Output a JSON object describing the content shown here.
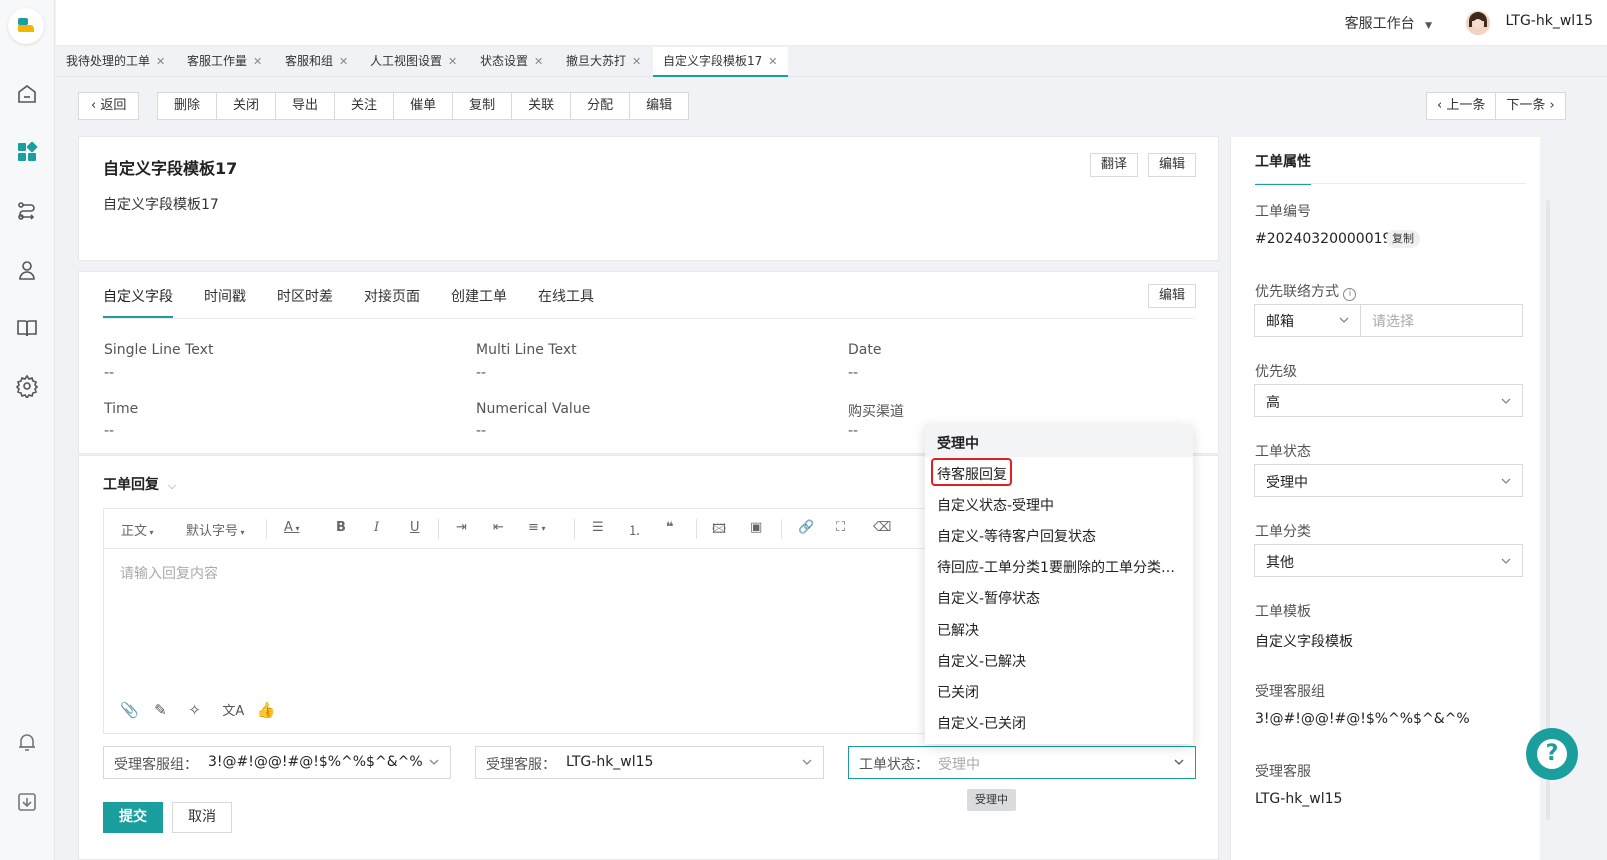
{
  "topbar": {
    "workbench": "客服工作台",
    "username": "LTG-hk_wl15"
  },
  "tabs": [
    {
      "label": "我待处理的工单"
    },
    {
      "label": "客服工作量"
    },
    {
      "label": "客服和组"
    },
    {
      "label": "人工视图设置"
    },
    {
      "label": "状态设置"
    },
    {
      "label": "撤旦大苏打"
    },
    {
      "label": "自定义字段模板17",
      "active": true
    }
  ],
  "toolbar": {
    "back": "返回",
    "actions": [
      "删除",
      "关闭",
      "导出",
      "关注",
      "催单",
      "复制",
      "关联",
      "分配",
      "编辑"
    ],
    "prev": "上一条",
    "next": "下一条"
  },
  "ticket": {
    "title": "自定义字段模板17",
    "description": "自定义字段模板17",
    "translate_label": "翻译",
    "edit_label": "编辑"
  },
  "fields_card": {
    "tabs": [
      "自定义字段",
      "时间戳",
      "时区时差",
      "对接页面",
      "创建工单",
      "在线工具"
    ],
    "edit_label": "编辑",
    "fields": [
      {
        "label": "Single Line Text",
        "value": "--"
      },
      {
        "label": "Multi Line Text",
        "value": "--"
      },
      {
        "label": "Date",
        "value": "--"
      },
      {
        "label": "Time",
        "value": "--"
      },
      {
        "label": "Numerical Value",
        "value": "--"
      },
      {
        "label": "购买渠道",
        "value": "--"
      }
    ]
  },
  "reply": {
    "title": "工单回复",
    "toolbar_text": {
      "paragraph": "正文",
      "font_size": "默认字号"
    },
    "placeholder": "请输入回复内容",
    "group_label": "受理客服组：",
    "group_value": "3!@#!@@!#@!$%^%$^&^%",
    "agent_label": "受理客服：",
    "agent_value": "LTG-hk_wl15",
    "status_label": "工单状态：",
    "status_value": "受理中",
    "submit": "提交",
    "cancel": "取消"
  },
  "status_dropdown": {
    "options": [
      "受理中",
      "待客服回复",
      "自定义状态-受理中",
      "自定义-等待客户回复状态",
      "待回应-工单分类1要删除的工单分类1...",
      "自定义-暂停状态",
      "已解决",
      "自定义-已解决",
      "已关闭",
      "自定义-已关闭"
    ],
    "selected": "受理中",
    "highlighted": "待客服回复"
  },
  "tooltip": "受理中",
  "properties": {
    "title": "工单属性",
    "ticket_no_label": "工单编号",
    "ticket_no": "#20240320000019",
    "copy_label": "复制",
    "contact_label": "优先联络方式",
    "contact_value": "邮箱",
    "contact_placeholder": "请选择",
    "priority_label": "优先级",
    "priority_value": "高",
    "status_label": "工单状态",
    "status_value": "受理中",
    "category_label": "工单分类",
    "category_value": "其他",
    "template_label": "工单模板",
    "template_value": "自定义字段模板",
    "group_label": "受理客服组",
    "group_value": "3!@#!@@!#@!$%^%$^&^%",
    "agent_label": "受理客服",
    "agent_value": "LTG-hk_wl15"
  },
  "colors": {
    "accent": "#1a9e9e",
    "highlight_border": "#e02020"
  }
}
